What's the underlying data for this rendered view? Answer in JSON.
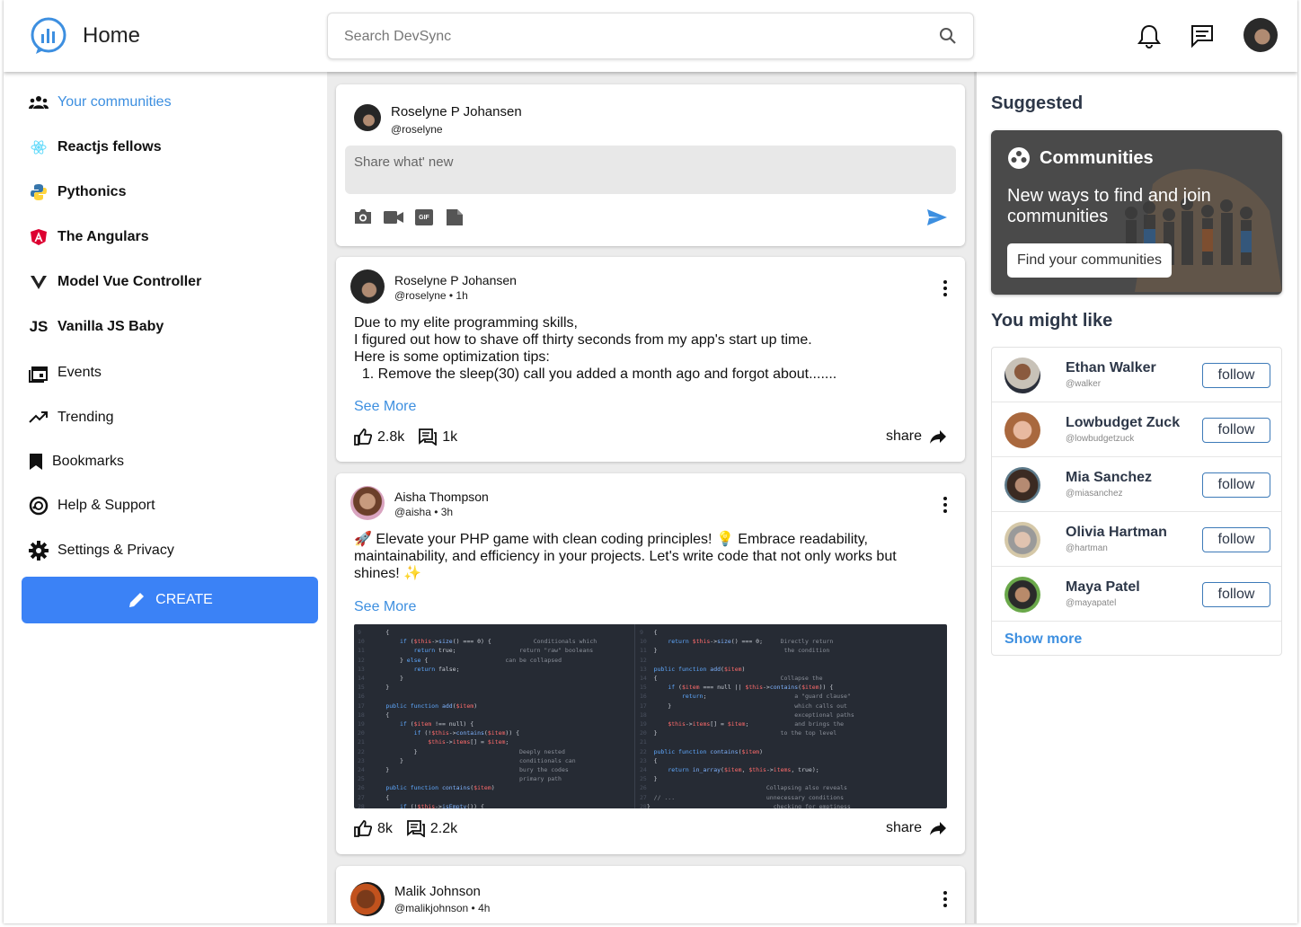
{
  "header": {
    "title": "Home",
    "search_placeholder": "Search DevSync"
  },
  "sidebar": {
    "items": [
      {
        "label": "Your communities",
        "icon": "people-icon"
      },
      {
        "label": "Reactjs fellows",
        "icon": "react-icon"
      },
      {
        "label": "Pythonics",
        "icon": "python-icon"
      },
      {
        "label": "The Angulars",
        "icon": "angular-icon"
      },
      {
        "label": "Model Vue Controller",
        "icon": "vue-icon"
      },
      {
        "label": "Vanilla JS Baby",
        "icon": "js-icon"
      },
      {
        "label": "Events",
        "icon": "calendar-icon"
      },
      {
        "label": "Trending",
        "icon": "trending-icon"
      },
      {
        "label": "Bookmarks",
        "icon": "bookmark-icon"
      },
      {
        "label": "Help & Support",
        "icon": "help-icon"
      },
      {
        "label": "Settings & Privacy",
        "icon": "gear-icon"
      }
    ],
    "create_label": "CREATE",
    "js_badge": "JS"
  },
  "composer": {
    "name": "Roselyne  P Johansen",
    "handle": "@roselyne",
    "placeholder": "Share what' new",
    "gif_label": "GIF"
  },
  "posts": [
    {
      "name": "Roselyne  P Johansen",
      "meta": "@roselyne • 1h",
      "lines": [
        "Due to my elite programming skills,",
        "I figured out how to shave off thirty seconds from my app's start up time.",
        "Here is some optimization tips:",
        "  1. Remove the sleep(30) call you added a month ago and forgot about......."
      ],
      "see_more": "See More",
      "likes": "2.8k",
      "comments": "1k",
      "share": "share"
    },
    {
      "name": "Aisha Thompson",
      "meta": "@aisha • 3h",
      "lines": [
        "🚀 Elevate your PHP game with clean coding principles! 💡 Embrace readability,",
        "maintainability, and efficiency in your projects. Let's write code that not only works but",
        "shines! ✨"
      ],
      "see_more": "See More",
      "likes": "8k",
      "comments": "2.2k",
      "share": "share"
    },
    {
      "name": "Malik Johnson",
      "meta": "@malikjohnson • 4h"
    }
  ],
  "suggested": {
    "heading": "Suggested",
    "promo_title": "Communities",
    "promo_text": "New ways to find and join communities",
    "promo_button": "Find your communities"
  },
  "might_like": {
    "heading": "You might like",
    "follow_label": "follow",
    "users": [
      {
        "name": "Ethan Walker",
        "handle": "@walker"
      },
      {
        "name": "Lowbudget Zuck",
        "handle": "@lowbudgetzuck"
      },
      {
        "name": "Mia Sanchez",
        "handle": "@miasanchez"
      },
      {
        "name": "Olivia Hartman",
        "handle": "@hartman"
      },
      {
        "name": "Maya Patel",
        "handle": "@mayapatel"
      }
    ],
    "show_more": "Show more"
  },
  "colors": {
    "accent": "#3d8fe0",
    "create_button": "#3b82f6",
    "feed_background": "#ececec"
  }
}
